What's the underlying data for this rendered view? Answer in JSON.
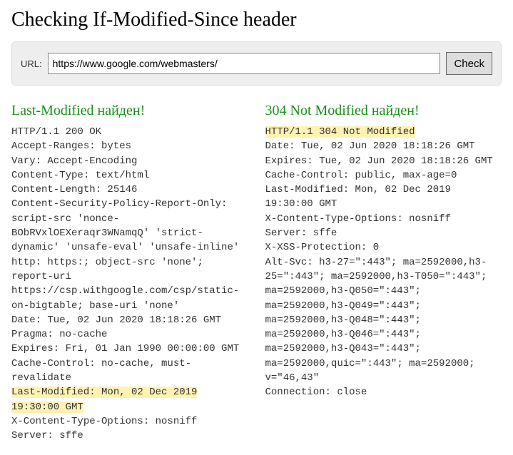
{
  "page": {
    "title": "Checking If-Modified-Since header"
  },
  "form": {
    "url_label": "URL:",
    "url_value": "https://www.google.com/webmasters/",
    "check_label": "Check"
  },
  "left": {
    "heading": "Last-Modified найден!",
    "lines_before": "HTTP/1.1 200 OK\nAccept-Ranges: bytes\nVary: Accept-Encoding\nContent-Type: text/html\nContent-Length: 25146\nContent-Security-Policy-Report-Only: script-src 'nonce-BObRVxlOEXeraqr3WNamqQ' 'strict-dynamic' 'unsafe-eval' 'unsafe-inline' http: https:; object-src 'none'; report-uri https://csp.withgoogle.com/csp/static-on-bigtable; base-uri 'none'\nDate: Tue, 02 Jun 2020 18:18:26 GMT\nPragma: no-cache\nExpires: Fri, 01 Jan 1990 00:00:00 GMT\nCache-Control: no-cache, must-revalidate",
    "highlight": "Last-Modified: Mon, 02 Dec 2019 19:30:00 GMT",
    "lines_after": "X-Content-Type-Options: nosniff\nServer: sffe"
  },
  "right": {
    "heading": "304 Not Modified найден!",
    "highlight": "HTTP/1.1 304 Not Modified",
    "lines_after": "Date: Tue, 02 Jun 2020 18:18:26 GMT\nExpires: Tue, 02 Jun 2020 18:18:26 GMT\nCache-Control: public, max-age=0\nLast-Modified: Mon, 02 Dec 2019 19:30:00 GMT\nX-Content-Type-Options: nosniff\nServer: sffe\nX-XSS-Protection: 0\nAlt-Svc: h3-27=\":443\"; ma=2592000,h3-25=\":443\"; ma=2592000,h3-T050=\":443\"; ma=2592000,h3-Q050=\":443\"; ma=2592000,h3-Q049=\":443\"; ma=2592000,h3-Q048=\":443\"; ma=2592000,h3-Q046=\":443\"; ma=2592000,h3-Q043=\":443\"; ma=2592000,quic=\":443\"; ma=2592000; v=\"46,43\"\nConnection: close"
  }
}
